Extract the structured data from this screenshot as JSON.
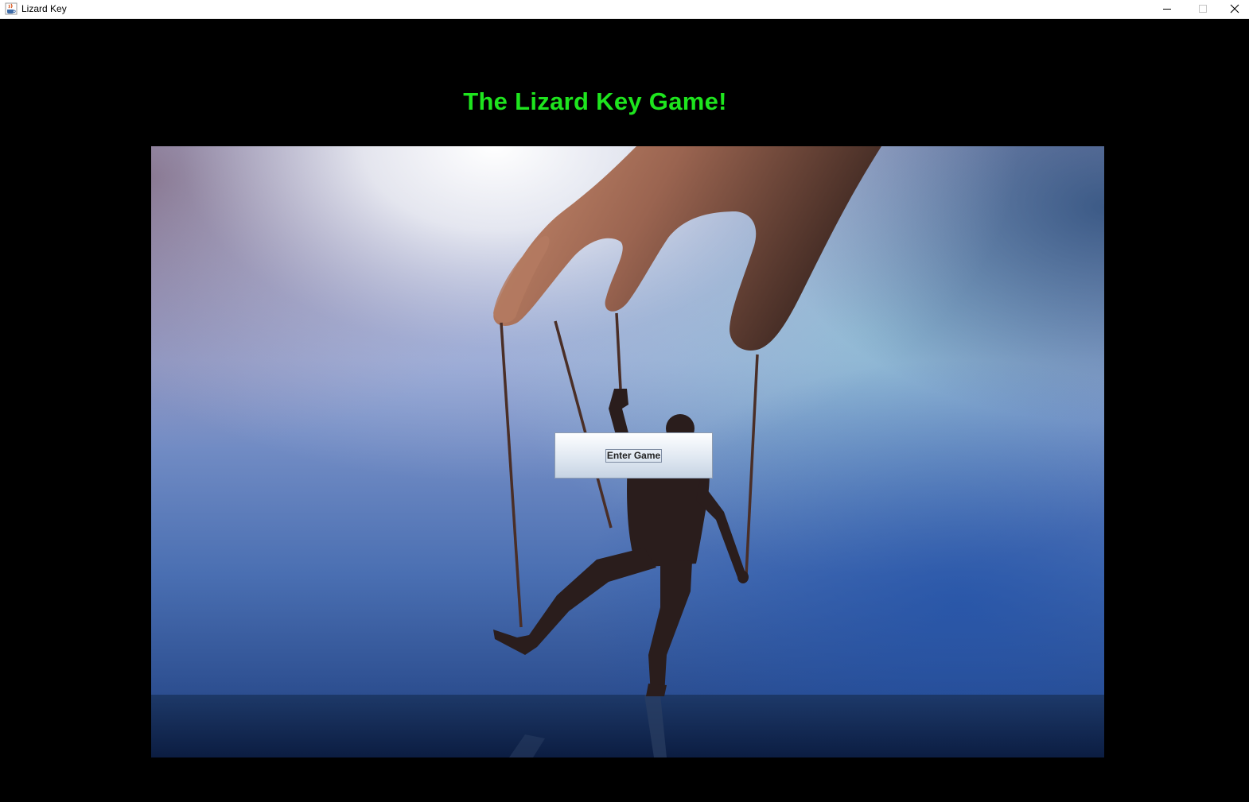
{
  "window": {
    "title": "Lizard Key",
    "app_icon": "java-coffee-icon",
    "controls": {
      "minimize_icon": "minimize-icon",
      "maximize_icon": "maximize-icon",
      "close_icon": "close-icon"
    }
  },
  "main": {
    "heading": "The Lizard Key Game!",
    "heading_color": "#1ee51e",
    "background_color": "#000000",
    "scene_image": "puppet-master-hand-controlling-man-on-strings",
    "enter_button_label": "Enter Game"
  }
}
